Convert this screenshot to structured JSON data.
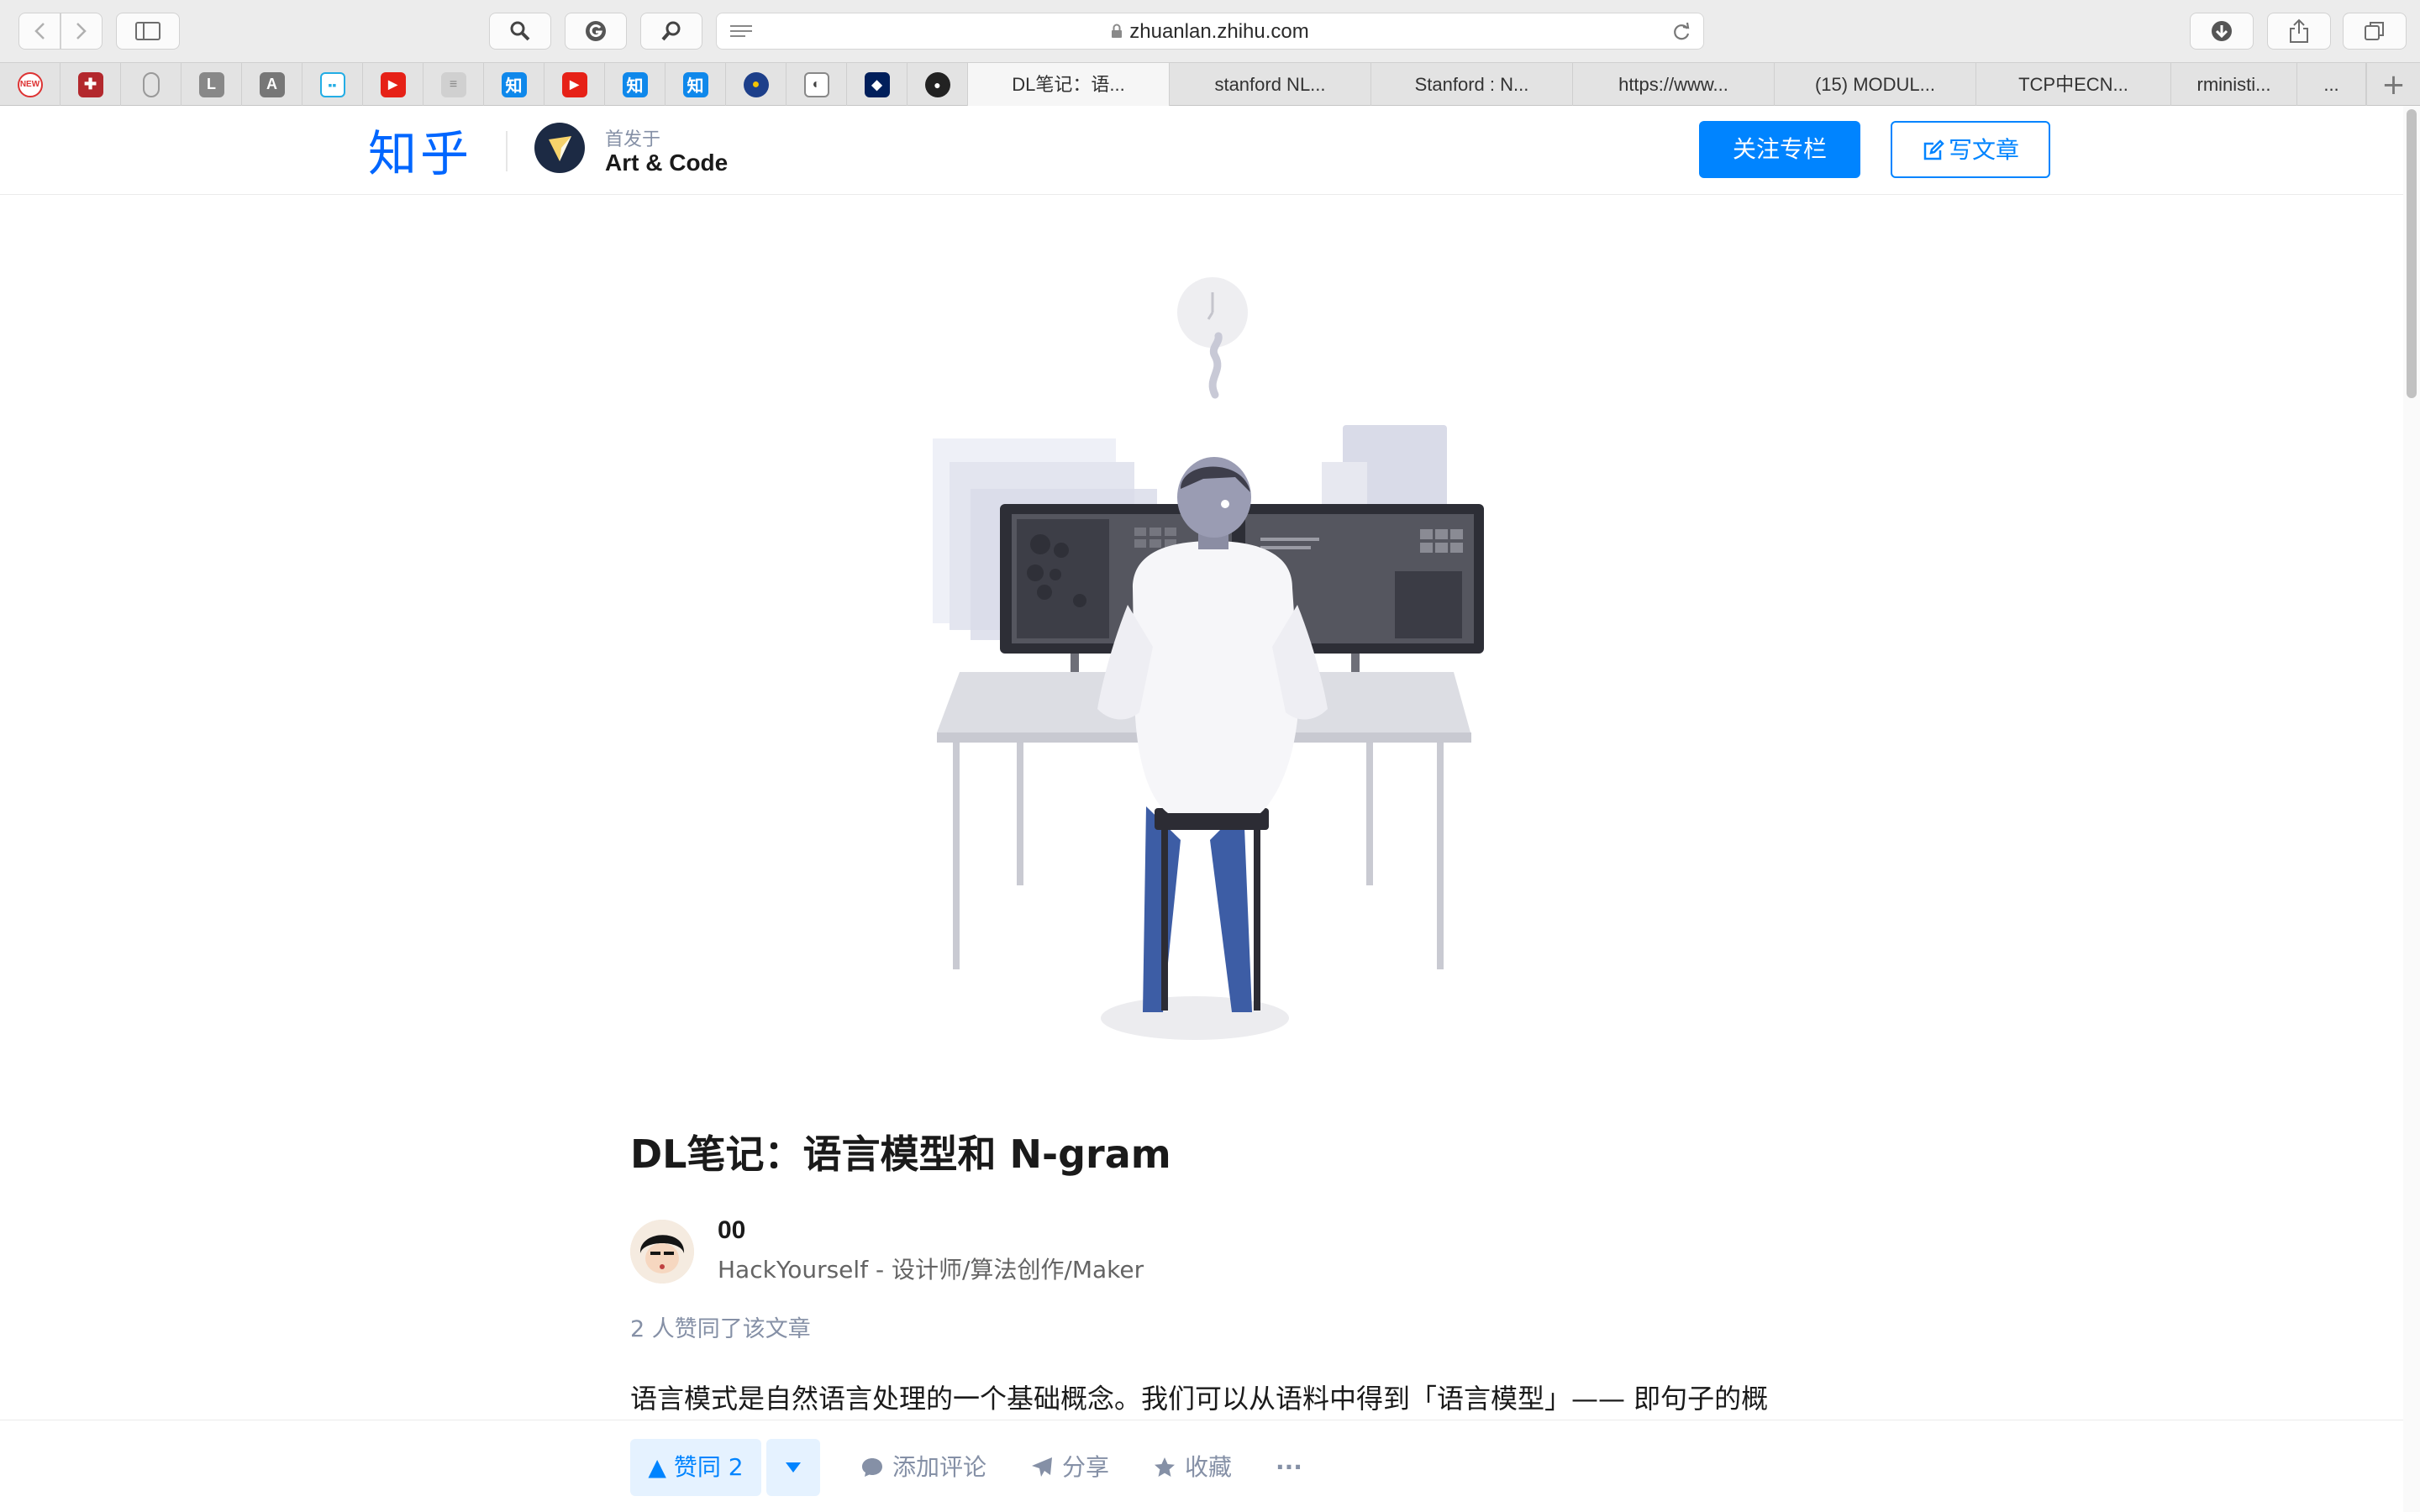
{
  "browser": {
    "url_host": "zhuanlan.zhihu.com",
    "tabs": [
      {
        "label": "DL笔记：语...",
        "active": true
      },
      {
        "label": "stanford NL..."
      },
      {
        "label": "Stanford : N..."
      },
      {
        "label": "https://www..."
      },
      {
        "label": "(15) MODUL..."
      },
      {
        "label": "TCP中ECN..."
      },
      {
        "label": "rministi..."
      },
      {
        "label": "..."
      }
    ],
    "favorites": [
      "new-icon",
      "crest-icon",
      "mouse-icon",
      "L",
      "A",
      "bilibili-icon",
      "youtube-icon",
      "grid-icon",
      "知",
      "youtube-icon",
      "知",
      "知",
      "mint-icon",
      "doc-icon",
      "penn-icon",
      "github-icon"
    ],
    "new_tab": "+"
  },
  "header": {
    "logo": "知乎",
    "first_published": "首发于",
    "column_name": "Art & Code",
    "follow_button": "关注专栏",
    "write_button": "写文章"
  },
  "article": {
    "title": "DL笔记：语言模型和 N-gram",
    "author": {
      "name": "00",
      "bio": "HackYourself - 设计师/算法创作/Maker"
    },
    "likes_text": "2 人赞同了该文章",
    "first_line": "语言模式是自然语言处理的一个基础概念。我们可以从语料中得到「语言模型」—— 即句子的概"
  },
  "actions": {
    "vote_label": "▲ 赞同 2",
    "comment": "添加评论",
    "share": "分享",
    "favorite": "收藏",
    "more": "···"
  },
  "colors": {
    "accent": "#0084ff",
    "logo": "#0066ff",
    "muted": "#8590a6"
  }
}
